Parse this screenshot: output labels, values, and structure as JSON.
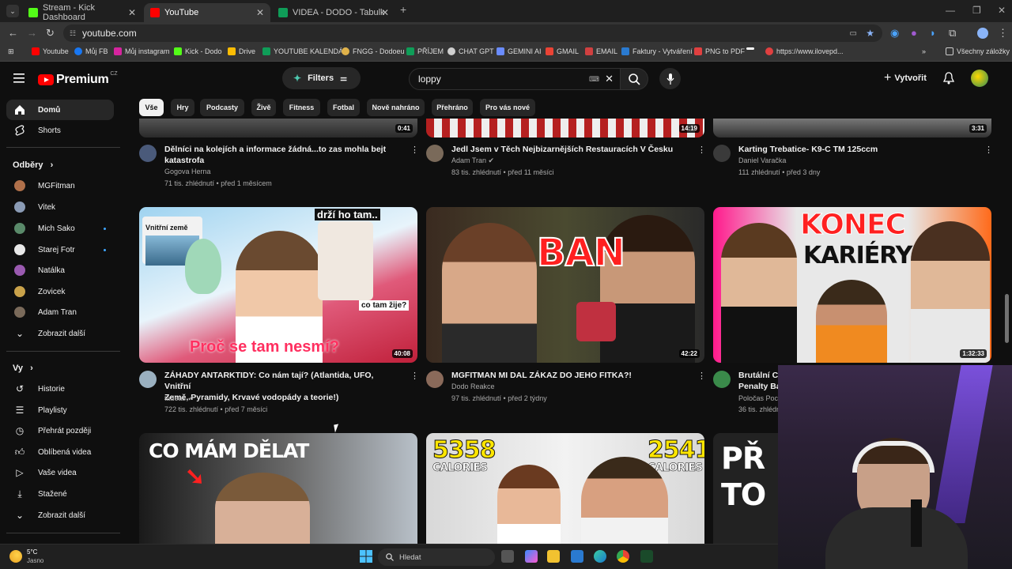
{
  "browser": {
    "tabs": [
      {
        "title": "Stream - Kick Dashboard",
        "color": "#53fc18"
      },
      {
        "title": "YouTube",
        "color": "#ff0000"
      },
      {
        "title": "VIDEA - DODO - Tabulky Googl",
        "color": "#0f9d58"
      }
    ],
    "url": "youtube.com",
    "bookmarks": [
      "Youtube",
      "Můj FB",
      "Můj instagram",
      "Kick - Dodo",
      "Drive",
      "YOUTUBE KALENDÁŘ",
      "FNGG - Dodoeu",
      "PŘÍJEM",
      "CHAT GPT",
      "GEMINI AI",
      "GMAIL",
      "EMAIL",
      "Faktury - Vytváření",
      "PNG to PDF",
      "",
      "https://www.ilovepd..."
    ],
    "all_bookmarks": "Všechny záložky"
  },
  "header": {
    "logo_text": "Premium",
    "logo_region": "CZ",
    "filters_label": "Filters",
    "search_value": "loppy",
    "create_label": "Vytvořit"
  },
  "sidebar": {
    "main": [
      {
        "label": "Domů",
        "icon": "home-icon"
      },
      {
        "label": "Shorts",
        "icon": "shorts-icon"
      }
    ],
    "subs_heading": "Odběry",
    "subs": [
      {
        "label": "MGFitman",
        "color": "#b0704a",
        "dot": false
      },
      {
        "label": "Vitek",
        "color": "#8a9bb5",
        "dot": false
      },
      {
        "label": "Mich Sako",
        "color": "#5a8a6a",
        "dot": true
      },
      {
        "label": "Starej Fotr",
        "color": "#e8e8e8",
        "dot": true
      },
      {
        "label": "Natálka",
        "color": "#9a5ab0",
        "dot": false
      },
      {
        "label": "Zovicek",
        "color": "#c9a24a",
        "dot": false
      },
      {
        "label": "Adam Tran",
        "color": "#7a6a5a",
        "dot": false
      }
    ],
    "subs_more": "Zobrazit další",
    "you_heading": "Vy",
    "you": [
      {
        "label": "Historie",
        "icon": "history-icon"
      },
      {
        "label": "Playlisty",
        "icon": "playlist-icon"
      },
      {
        "label": "Přehrát později",
        "icon": "watch-later-icon"
      },
      {
        "label": "Oblíbená videa",
        "icon": "like-icon"
      },
      {
        "label": "Vaše videa",
        "icon": "your-videos-icon"
      },
      {
        "label": "Stažené",
        "icon": "download-icon"
      }
    ],
    "you_more": "Zobrazit další"
  },
  "chips": [
    "Vše",
    "Hry",
    "Podcasty",
    "Živě",
    "Fitness",
    "Fotbal",
    "Nově nahráno",
    "Přehráno",
    "Pro vás nové"
  ],
  "row1": [
    {
      "title_l1": "Dělníci na kolejích a informace žádná...to zas mohla bejt",
      "title_l2": "katastrofa",
      "channel": "Gogova Herna",
      "stats": "71 tis. zhlédnutí • před 1 měsícem",
      "duration": "0:41"
    },
    {
      "title_l1": "Jedl Jsem v Těch Nejbizarnějších Restauracích V Česku",
      "title_l2": "",
      "channel": "Adam Tran ✔",
      "stats": "83 tis. zhlédnutí • před 11 měsíci",
      "duration": "14:19"
    },
    {
      "title_l1": "Karting Trebatice- K9-C TM 125ccm",
      "title_l2": "",
      "channel": "Daniel Varačka",
      "stats": "111 zhlédnutí • před 3 dny",
      "duration": "3:31"
    }
  ],
  "row2": [
    {
      "title_l1": "ZÁHADY ANTARKTIDY: Co nám tají? (Atlantida, UFO, Vnitřní",
      "title_l2": "Země, Pyramidy, Krvavé vodopády a teorie!)",
      "channel": "tadeas ✔",
      "stats": "722 tis. zhlédnutí • před 7 měsíci",
      "duration": "40:08",
      "thumb_text": "Proč se tam nesmí?",
      "tag1": "Vnitřní země",
      "tag2": "drží ho tam..",
      "tag3": "co tam žije?"
    },
    {
      "title_l1": "MGFITMAN MI DAL ZÁKAZ DO JEHO FITKA?!",
      "title_l2": "",
      "channel": "Dodo Reakce",
      "stats": "97 tis. zhlédnutí • před 2 týdny",
      "duration": "42:22",
      "thumb_text": "BAN"
    },
    {
      "title_l1": "Brutální Ch",
      "title_l2": "Penalty Ba",
      "channel": "Poločas Poc",
      "stats": "36 tis. zhlédn",
      "duration": "1:32:33",
      "thumb_text": "KONEC",
      "thumb_text2": "KARIÉRY?"
    }
  ],
  "row3": [
    {
      "thumb_text": "CO MÁM DĚLAT"
    },
    {
      "cal1": "5358",
      "cal2": "2541",
      "cal_label": "CALORIES"
    },
    {
      "thumb_text": "PŘ",
      "thumb_text2": "TO"
    }
  ],
  "taskbar": {
    "weather_temp": "5°C",
    "weather_desc": "Jasno",
    "search": "Hledat"
  }
}
